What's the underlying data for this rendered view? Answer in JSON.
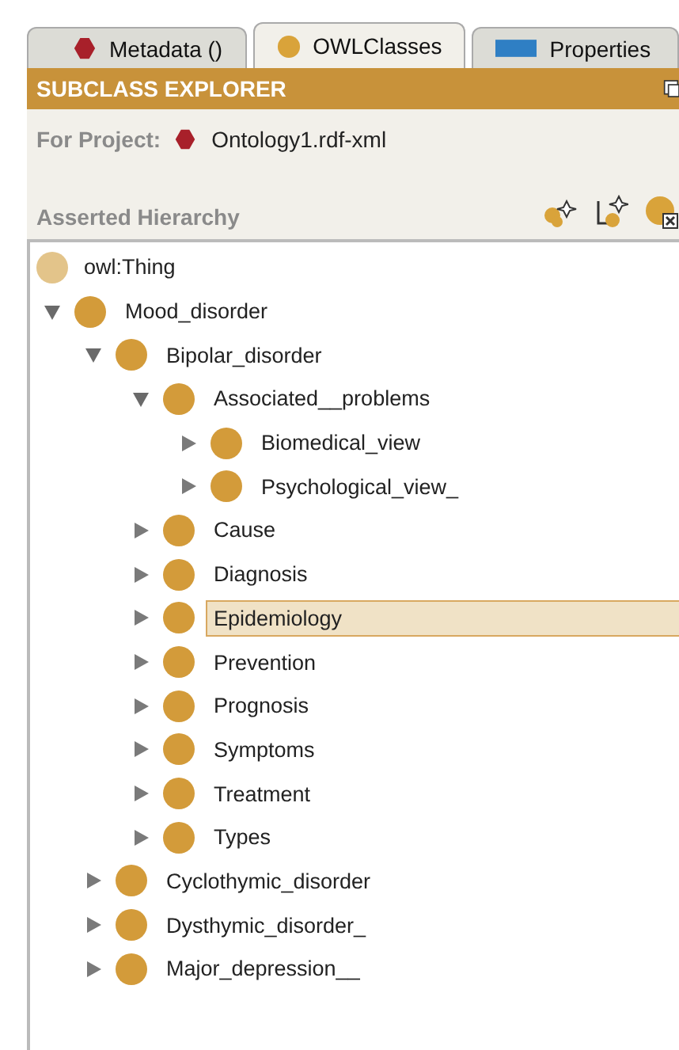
{
  "tabs": [
    {
      "label": "Metadata ()",
      "kind": "hexagon",
      "selected": false
    },
    {
      "label": "OWLClasses",
      "kind": "circle",
      "selected": true
    },
    {
      "label": "Properties",
      "kind": "rect",
      "selected": false
    }
  ],
  "panel": {
    "title": "SUBCLASS EXPLORER",
    "project_label": "For Project:",
    "project_name": "Ontology1.rdf-xml",
    "hierarchy_title": "Asserted Hierarchy"
  },
  "tree": {
    "root": "owl:Thing",
    "children": [
      {
        "label": "Mood_disorder",
        "expanded": true,
        "selected": false,
        "children": [
          {
            "label": "Bipolar_disorder",
            "expanded": true,
            "selected": false,
            "children": [
              {
                "label": "Associated__problems",
                "expanded": true,
                "selected": false,
                "children": [
                  {
                    "label": "Biomedical_view",
                    "expanded": false,
                    "selected": false
                  },
                  {
                    "label": "Psychological_view_",
                    "expanded": false,
                    "selected": false
                  }
                ]
              },
              {
                "label": "Cause",
                "expanded": false,
                "selected": false
              },
              {
                "label": "Diagnosis",
                "expanded": false,
                "selected": false
              },
              {
                "label": "Epidemiology",
                "expanded": false,
                "selected": true
              },
              {
                "label": "Prevention",
                "expanded": false,
                "selected": false
              },
              {
                "label": "Prognosis",
                "expanded": false,
                "selected": false
              },
              {
                "label": "Symptoms",
                "expanded": false,
                "selected": false
              },
              {
                "label": "Treatment",
                "expanded": false,
                "selected": false
              },
              {
                "label": "Types",
                "expanded": false,
                "selected": false
              }
            ]
          },
          {
            "label": "Cyclothymic_disorder",
            "expanded": false,
            "selected": false
          },
          {
            "label": "Dysthymic_disorder_",
            "expanded": false,
            "selected": false
          },
          {
            "label": "Major_depression__",
            "expanded": false,
            "selected": false
          }
        ]
      }
    ]
  }
}
